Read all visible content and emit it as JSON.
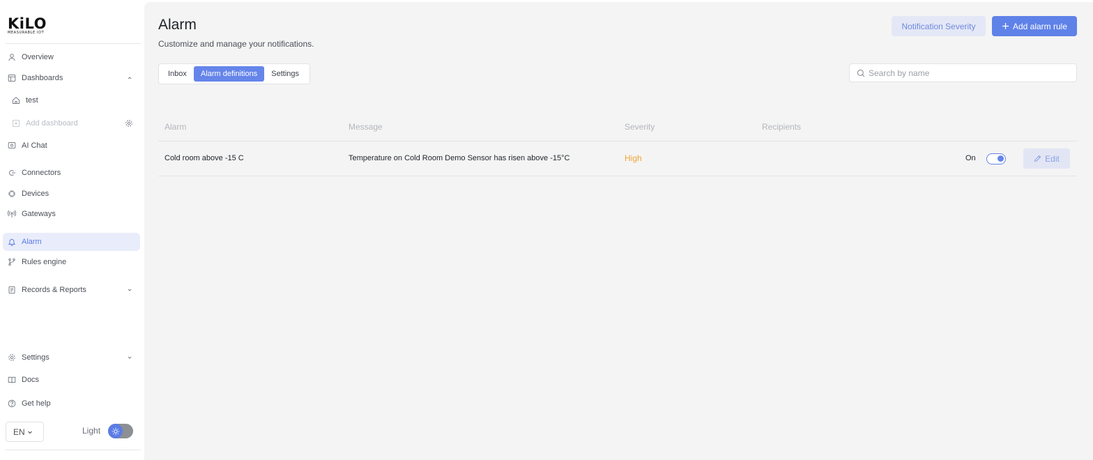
{
  "brand": {
    "name": "KiLO",
    "tagline": "MEASURABLE IOT"
  },
  "sidebar": {
    "items": [
      {
        "label": "Overview",
        "icon": "user-icon"
      },
      {
        "label": "Dashboards",
        "icon": "dashboard-icon",
        "expanded": true
      },
      {
        "label": "test",
        "icon": "home-icon"
      },
      {
        "label": "Add dashboard",
        "icon": "plus-square-icon",
        "disabled": true
      },
      {
        "label": "AI Chat",
        "icon": "ai-chat-icon"
      },
      {
        "label": "Connectors",
        "icon": "connector-icon"
      },
      {
        "label": "Devices",
        "icon": "chip-icon"
      },
      {
        "label": "Gateways",
        "icon": "antenna-icon"
      },
      {
        "label": "Alarm",
        "icon": "bell-icon",
        "active": true
      },
      {
        "label": "Rules engine",
        "icon": "branch-icon"
      },
      {
        "label": "Records & Reports",
        "icon": "report-icon",
        "expanded": false
      },
      {
        "label": "Settings",
        "icon": "gear-icon",
        "expanded": false
      },
      {
        "label": "Docs",
        "icon": "book-icon"
      },
      {
        "label": "Get help",
        "icon": "help-icon"
      }
    ],
    "language": "EN",
    "theme_label": "Light"
  },
  "header": {
    "title": "Alarm",
    "subtitle": "Customize and manage your notifications.",
    "notification_severity_label": "Notification Severity",
    "add_rule_label": "Add alarm rule"
  },
  "tabs": [
    {
      "label": "Inbox"
    },
    {
      "label": "Alarm definitions",
      "active": true
    },
    {
      "label": "Settings"
    }
  ],
  "search": {
    "placeholder": "Search by name",
    "value": ""
  },
  "table": {
    "columns": [
      "Alarm",
      "Message",
      "Severity",
      "Recipients"
    ],
    "rows": [
      {
        "alarm": "Cold room above -15 C",
        "message": "Temperature on Cold Room Demo Sensor has risen above -15°C",
        "severity": "High",
        "recipients": "",
        "status_label": "On",
        "enabled": true,
        "edit_label": "Edit"
      }
    ]
  },
  "colors": {
    "accent": "#5f82e8",
    "severity_high": "#f0a537",
    "active_nav_bg": "#e9edfb"
  }
}
